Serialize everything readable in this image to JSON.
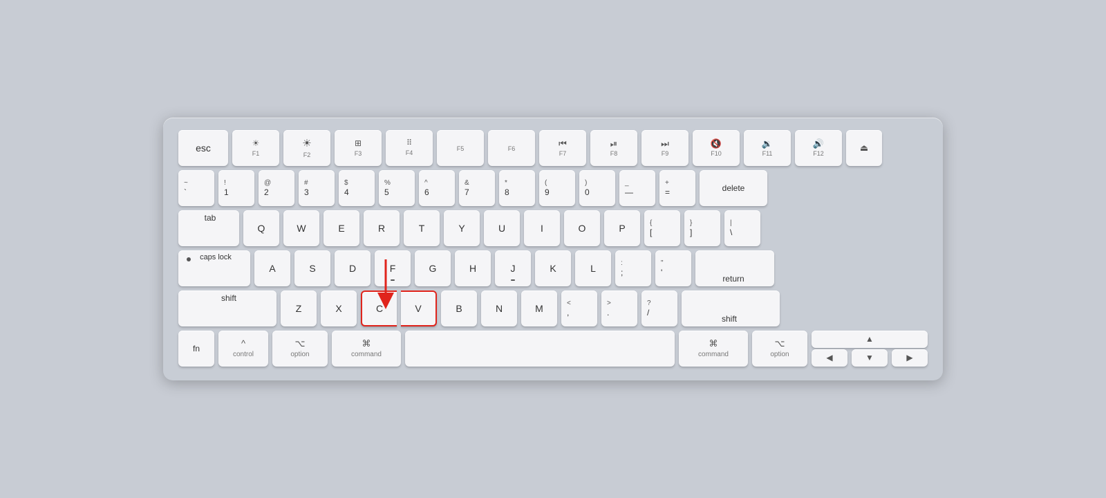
{
  "keyboard": {
    "rows": [
      {
        "id": "fn-row",
        "keys": [
          {
            "id": "esc",
            "label": "esc",
            "class": "key-esc",
            "type": "text"
          },
          {
            "id": "f1",
            "icon": "☀",
            "sub": "F1",
            "class": "key-f1",
            "type": "icon-sub"
          },
          {
            "id": "f2",
            "icon": "☀",
            "sub": "F2",
            "class": "key-f2",
            "type": "icon-sub",
            "iconLarge": true
          },
          {
            "id": "f3",
            "icon": "⊞",
            "sub": "F3",
            "class": "key-f3",
            "type": "icon-sub"
          },
          {
            "id": "f4",
            "icon": "⊞⊞",
            "sub": "F4",
            "class": "key-f4",
            "type": "icon-sub"
          },
          {
            "id": "f5",
            "label": "",
            "sub": "F5",
            "class": "key-f5",
            "type": "sub-only"
          },
          {
            "id": "f6",
            "label": "",
            "sub": "F6",
            "class": "key-f6",
            "type": "sub-only"
          },
          {
            "id": "f7",
            "icon": "⏮",
            "sub": "F7",
            "class": "key-f7",
            "type": "icon-sub"
          },
          {
            "id": "f8",
            "icon": "⏯",
            "sub": "F8",
            "class": "key-f8",
            "type": "icon-sub"
          },
          {
            "id": "f9",
            "icon": "⏭",
            "sub": "F9",
            "class": "key-f9",
            "type": "icon-sub"
          },
          {
            "id": "f10",
            "icon": "🔇",
            "sub": "F10",
            "class": "key-f10",
            "type": "icon-sub"
          },
          {
            "id": "f11",
            "icon": "🔉",
            "sub": "F11",
            "class": "key-f11",
            "type": "icon-sub"
          },
          {
            "id": "f12",
            "icon": "🔊",
            "sub": "F12",
            "class": "key-f12",
            "type": "icon-sub"
          },
          {
            "id": "eject",
            "icon": "⏏",
            "class": "key-eject",
            "type": "center"
          }
        ]
      },
      {
        "id": "number-row",
        "keys": [
          {
            "id": "tilde",
            "top": "~",
            "bottom": "`",
            "class": "",
            "type": "top-bottom"
          },
          {
            "id": "1",
            "top": "!",
            "bottom": "1",
            "class": "",
            "type": "top-bottom"
          },
          {
            "id": "2",
            "top": "@",
            "bottom": "2",
            "class": "",
            "type": "top-bottom"
          },
          {
            "id": "3",
            "top": "#",
            "bottom": "3",
            "class": "",
            "type": "top-bottom"
          },
          {
            "id": "4",
            "top": "$",
            "bottom": "4",
            "class": "",
            "type": "top-bottom"
          },
          {
            "id": "5",
            "top": "%",
            "bottom": "5",
            "class": "",
            "type": "top-bottom"
          },
          {
            "id": "6",
            "top": "^",
            "bottom": "6",
            "class": "",
            "type": "top-bottom"
          },
          {
            "id": "7",
            "top": "&",
            "bottom": "7",
            "class": "",
            "type": "top-bottom"
          },
          {
            "id": "8",
            "top": "*",
            "bottom": "8",
            "class": "",
            "type": "top-bottom"
          },
          {
            "id": "9",
            "top": "(",
            "bottom": "9",
            "class": "",
            "type": "top-bottom"
          },
          {
            "id": "0",
            "top": ")",
            "bottom": "0",
            "class": "",
            "type": "top-bottom"
          },
          {
            "id": "minus",
            "top": "_",
            "bottom": "—",
            "class": "",
            "type": "top-bottom"
          },
          {
            "id": "equal",
            "top": "+",
            "bottom": "=",
            "class": "",
            "type": "top-bottom"
          },
          {
            "id": "delete",
            "label": "delete",
            "class": "key-delete",
            "type": "text"
          }
        ]
      },
      {
        "id": "qwerty-row",
        "keys": [
          {
            "id": "tab",
            "label": "tab",
            "class": "key-tab",
            "type": "text"
          },
          {
            "id": "q",
            "label": "Q",
            "class": "",
            "type": "center"
          },
          {
            "id": "w",
            "label": "W",
            "class": "",
            "type": "center"
          },
          {
            "id": "e",
            "label": "E",
            "class": "",
            "type": "center"
          },
          {
            "id": "r",
            "label": "R",
            "class": "",
            "type": "center"
          },
          {
            "id": "t",
            "label": "T",
            "class": "",
            "type": "center"
          },
          {
            "id": "y",
            "label": "Y",
            "class": "",
            "type": "center"
          },
          {
            "id": "u",
            "label": "U",
            "class": "",
            "type": "center"
          },
          {
            "id": "i",
            "label": "I",
            "class": "",
            "type": "center"
          },
          {
            "id": "o",
            "label": "O",
            "class": "",
            "type": "center"
          },
          {
            "id": "p",
            "label": "P",
            "class": "",
            "type": "center"
          },
          {
            "id": "lbracket",
            "top": "{",
            "bottom": "[",
            "class": "",
            "type": "top-bottom"
          },
          {
            "id": "rbracket",
            "top": "}",
            "bottom": "]",
            "class": "",
            "type": "top-bottom"
          },
          {
            "id": "backslash",
            "top": "|",
            "bottom": "\\",
            "class": "",
            "type": "top-bottom"
          }
        ]
      },
      {
        "id": "asdf-row",
        "keys": [
          {
            "id": "caps",
            "label": "caps lock",
            "class": "key-caps",
            "type": "caps"
          },
          {
            "id": "a",
            "label": "A",
            "class": "",
            "type": "center"
          },
          {
            "id": "s",
            "label": "S",
            "class": "",
            "type": "center"
          },
          {
            "id": "d",
            "label": "D",
            "class": "",
            "type": "center"
          },
          {
            "id": "f",
            "label": "F",
            "class": "",
            "type": "center"
          },
          {
            "id": "g",
            "label": "G",
            "class": "",
            "type": "center"
          },
          {
            "id": "h",
            "label": "H",
            "class": "",
            "type": "center"
          },
          {
            "id": "j",
            "label": "J",
            "class": "",
            "type": "center"
          },
          {
            "id": "k",
            "label": "K",
            "class": "",
            "type": "center"
          },
          {
            "id": "l",
            "label": "L",
            "class": "",
            "type": "center"
          },
          {
            "id": "semicolon",
            "top": ":",
            "bottom": ";",
            "class": "",
            "type": "top-bottom"
          },
          {
            "id": "quote",
            "top": "\"",
            "bottom": "'",
            "class": "",
            "type": "top-bottom"
          },
          {
            "id": "return",
            "label": "return",
            "class": "key-return",
            "type": "text"
          }
        ]
      },
      {
        "id": "zxcv-row",
        "keys": [
          {
            "id": "shift-l",
            "label": "shift",
            "class": "key-shift-l",
            "type": "text"
          },
          {
            "id": "z",
            "label": "Z",
            "class": "",
            "type": "center"
          },
          {
            "id": "x",
            "label": "X",
            "class": "",
            "type": "center"
          },
          {
            "id": "c",
            "label": "C",
            "class": "key-highlighted",
            "type": "center"
          },
          {
            "id": "v",
            "label": "V",
            "class": "key-highlighted",
            "type": "center"
          },
          {
            "id": "b",
            "label": "B",
            "class": "",
            "type": "center"
          },
          {
            "id": "n",
            "label": "N",
            "class": "",
            "type": "center"
          },
          {
            "id": "m",
            "label": "M",
            "class": "",
            "type": "center"
          },
          {
            "id": "lt",
            "top": "<",
            "bottom": ",",
            "class": "",
            "type": "top-bottom"
          },
          {
            "id": "gt",
            "top": ">",
            "bottom": ".",
            "class": "",
            "type": "top-bottom"
          },
          {
            "id": "quest",
            "top": "?",
            "bottom": "/",
            "class": "",
            "type": "top-bottom"
          },
          {
            "id": "shift-r",
            "label": "shift",
            "class": "key-shift-r",
            "type": "text"
          }
        ]
      },
      {
        "id": "bottom-row",
        "keys": [
          {
            "id": "fn",
            "label": "fn",
            "class": "key-fn",
            "type": "text"
          },
          {
            "id": "control",
            "icon": "^",
            "label": "control",
            "class": "key-control",
            "type": "icon-label"
          },
          {
            "id": "option-l",
            "icon": "⌥",
            "label": "option",
            "class": "key-option",
            "type": "icon-label"
          },
          {
            "id": "command-l",
            "icon": "⌘",
            "label": "command",
            "class": "key-command-l",
            "type": "icon-label"
          },
          {
            "id": "space",
            "label": "",
            "class": "key-space",
            "type": "space"
          },
          {
            "id": "command-r",
            "icon": "⌘",
            "label": "command",
            "class": "key-command-r",
            "type": "icon-label"
          },
          {
            "id": "option-r",
            "icon": "⌥",
            "label": "option",
            "class": "key-option-r",
            "type": "icon-label"
          },
          {
            "id": "arrows",
            "type": "arrows"
          }
        ]
      }
    ]
  },
  "labels": {
    "esc": "esc",
    "tab": "tab",
    "caps_lock": "caps lock",
    "shift": "shift",
    "fn": "fn",
    "control": "control",
    "option": "option",
    "command": "command",
    "return": "return",
    "delete": "delete"
  }
}
